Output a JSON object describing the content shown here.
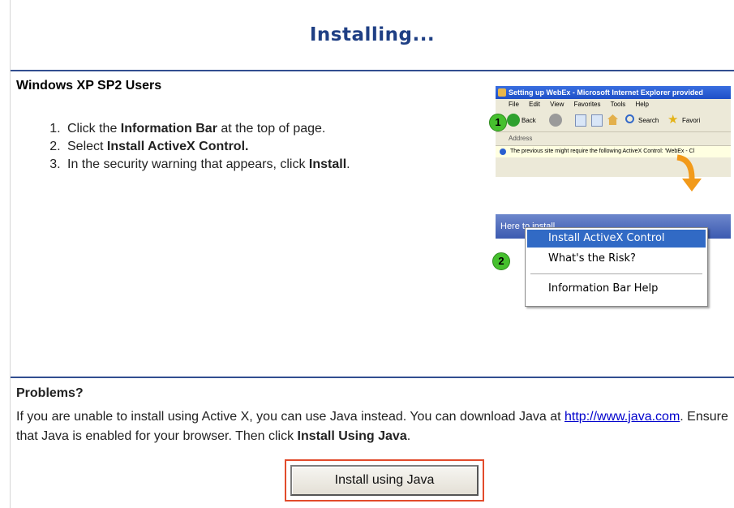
{
  "title": "Installing...",
  "section": {
    "heading": "Windows XP  SP2 Users",
    "steps": [
      {
        "pre": "Click the ",
        "bold": "Information Bar",
        "post": " at the top of page."
      },
      {
        "pre": "Select ",
        "bold": "Install ActiveX Control.",
        "post": ""
      },
      {
        "pre": "In the security warning that appears, click ",
        "bold": "Install",
        "post": "."
      }
    ]
  },
  "illustration": {
    "window_title": "Setting up WebEx - Microsoft Internet Explorer provided",
    "menu": [
      "File",
      "Edit",
      "View",
      "Favorites",
      "Tools",
      "Help"
    ],
    "toolbar_back": "Back",
    "toolbar_search": "Search",
    "toolbar_favorites": "Favori",
    "address_label": "Address",
    "infobar_text": "The previous site might require the following ActiveX Control: 'WebEx - Cl",
    "badge1": "1",
    "badge2": "2",
    "strip_text": "Here to install...",
    "context_menu": {
      "items": [
        "Install ActiveX Control",
        "What's the Risk?",
        "Information Bar Help"
      ]
    }
  },
  "problems": {
    "heading": "Problems?",
    "text_1": "If you are unable to install using Active X, you can use Java instead. You can download Java at ",
    "link": "http://www.java.com",
    "text_2": ". Ensure that Java is enabled for your browser. Then click ",
    "bold": "Install Using Java",
    "text_3": "."
  },
  "java_button_label": "Install using Java",
  "colors": {
    "title": "#1f3f84",
    "divider": "#314e90",
    "highlight_border": "#e24b2b",
    "menu_selection": "#316ac5"
  }
}
